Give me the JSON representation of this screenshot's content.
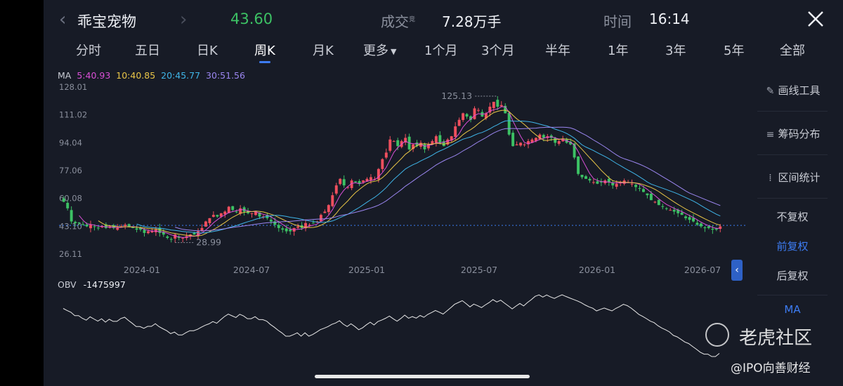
{
  "header": {
    "name": "乖宝宠物",
    "price": "43.60",
    "volume_label": "成交",
    "volume_sup": "竞",
    "volume_value": "7.28万手",
    "time_label": "时间",
    "time_value": "16:14",
    "price_color": "#3cc164"
  },
  "tabs": [
    "分时",
    "五日",
    "日K",
    "周K",
    "月K",
    "更多",
    "1个月",
    "3个月",
    "半年",
    "1年",
    "3年",
    "5年",
    "全部"
  ],
  "active_tab": "周K",
  "ma_legend": {
    "label": "MA",
    "items": [
      {
        "text": "5:40.93",
        "color": "#d94fd6"
      },
      {
        "text": "10:40.85",
        "color": "#e8c547"
      },
      {
        "text": "20:45.77",
        "color": "#3fb5e8"
      },
      {
        "text": "30:51.56",
        "color": "#9b86f0"
      }
    ]
  },
  "right_panel": {
    "draw_tool": "画线工具",
    "chip_dist": "筹码分布",
    "range_stats": "区间统计",
    "no_adjust": "不复权",
    "pre_adjust": "前复权",
    "post_adjust": "后复权",
    "ma": "MA",
    "selected": "前复权"
  },
  "obv_legend": {
    "label": "OBV",
    "value": "-1475997"
  },
  "watermark": {
    "brand": "老虎社区",
    "account": "@IPO向善财经"
  },
  "chart_data": {
    "type": "candlestick",
    "y_ticks": [
      "128.01",
      "111.02",
      "94.04",
      "77.06",
      "60.08",
      "43.10",
      "26.11"
    ],
    "ylim": [
      26.11,
      128.01
    ],
    "x_ticks": [
      "2024-01",
      "2024-07",
      "2025-01",
      "2025-07",
      "2026-01",
      "2026-07"
    ],
    "max_label": "125.13",
    "min_label": "28.99",
    "last_price": 43.6,
    "up_color": "#ef4f5e",
    "down_color": "#3cc164",
    "ma_colors": {
      "ma5": "#d94fd6",
      "ma10": "#e8c547",
      "ma20": "#3fb5e8",
      "ma30": "#9b86f0"
    },
    "close_series": [
      58,
      54,
      46,
      45,
      45,
      44,
      43,
      44,
      43,
      42,
      43,
      42,
      43,
      42,
      42,
      43,
      44,
      43,
      42,
      41,
      41,
      39,
      40,
      40,
      41,
      39,
      38,
      36,
      35,
      38,
      36,
      36,
      37,
      38,
      38,
      40,
      42,
      46,
      48,
      50,
      49,
      51,
      52,
      55,
      53,
      52,
      54,
      52,
      51,
      51,
      52,
      49,
      49,
      48,
      46,
      44,
      42,
      41,
      40,
      40,
      42,
      43,
      42,
      45,
      44,
      45,
      46,
      50,
      52,
      56,
      62,
      68,
      72,
      68,
      67,
      71,
      70,
      69,
      71,
      72,
      73,
      72,
      78,
      84,
      88,
      96,
      95,
      92,
      95,
      97,
      90,
      93,
      92,
      94,
      90,
      93,
      95,
      98,
      94,
      92,
      96,
      98,
      104,
      108,
      112,
      110,
      108,
      115,
      114,
      110,
      112,
      116,
      119,
      116,
      117,
      112,
      99,
      92,
      93,
      94,
      93,
      95,
      96,
      97,
      99,
      97,
      98,
      97,
      94,
      95,
      96,
      94,
      93,
      85,
      75,
      73,
      72,
      71,
      70,
      69,
      70,
      71,
      70,
      68,
      69,
      70,
      71,
      70,
      69,
      67,
      66,
      64,
      62,
      59,
      58,
      56,
      55,
      54,
      53,
      52,
      51,
      50,
      48,
      47,
      46,
      44,
      43,
      42,
      42,
      41,
      41,
      43
    ],
    "obv_note": "OBV line indicator"
  }
}
